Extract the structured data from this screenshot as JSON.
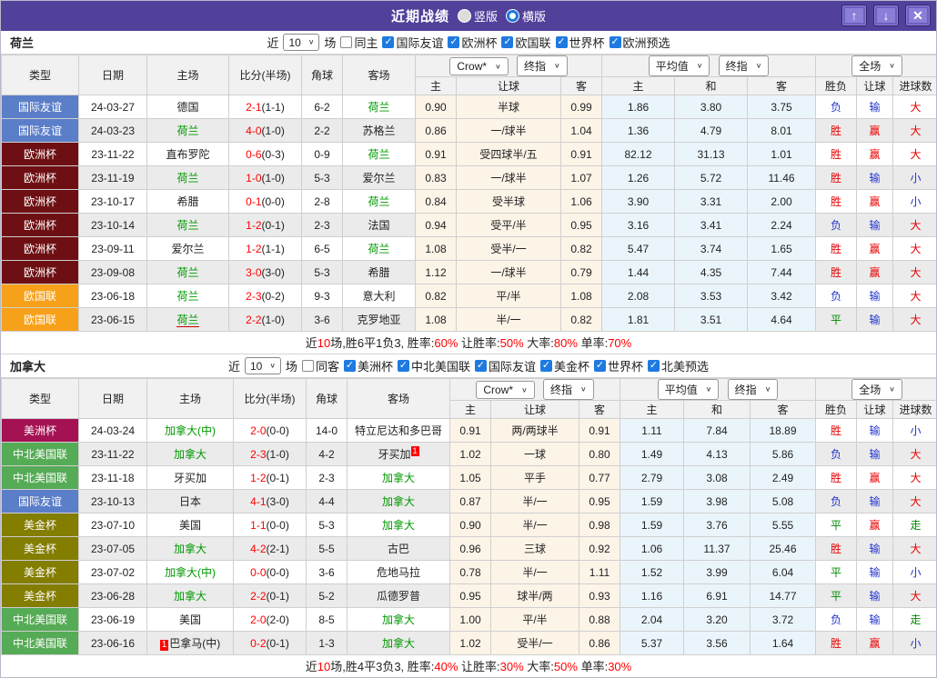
{
  "titlebar": {
    "title": "近期战绩",
    "radio_vertical": "竖版",
    "radio_horizontal": "横版",
    "up_icon": "↑",
    "down_icon": "↓",
    "close_icon": "✕"
  },
  "icons": {
    "caret": "∨",
    "check": "✓"
  },
  "table_header": {
    "type": "类型",
    "date": "日期",
    "home": "主场",
    "score": "比分(半场)",
    "corner": "角球",
    "away": "客场",
    "crow_select": "Crow*",
    "final_select": "终指",
    "avg_select": "平均值",
    "avg_final_select": "终指",
    "full_select": "全场",
    "sub_home": "主",
    "sub_handicap": "让球",
    "sub_away": "客",
    "sub_avg_home": "主",
    "sub_avg_draw": "和",
    "sub_avg_away": "客",
    "sub_wdl": "胜负",
    "sub_let": "让球",
    "sub_goals": "进球数"
  },
  "sections": [
    {
      "team": "荷兰",
      "filter": {
        "near": "近",
        "count": "10",
        "games": "场",
        "same": "同主",
        "leagues": [
          "国际友谊",
          "欧洲杯",
          "欧国联",
          "世界杯",
          "欧洲预选"
        ]
      },
      "rows": [
        {
          "type": "国际友谊",
          "type_bg": "#5b7ec8",
          "date": "24-03-27",
          "home": "德国",
          "score_full": "2-1",
          "score_half": "(1-1)",
          "corner": "6-2",
          "away": "荷兰",
          "away_green": true,
          "crow_home": "0.90",
          "crow_handicap": "半球",
          "crow_away": "0.99",
          "avg_home": "1.86",
          "avg_draw": "3.80",
          "avg_away": "3.75",
          "wdl": "负",
          "wdl_c": "b",
          "hres": "输",
          "hres_c": "b",
          "goals": "大",
          "goals_c": "r"
        },
        {
          "type": "国际友谊",
          "type_bg": "#5b7ec8",
          "date": "24-03-23",
          "home": "荷兰",
          "home_green": true,
          "score_full": "4-0",
          "score_half": "(1-0)",
          "corner": "2-2",
          "away": "苏格兰",
          "crow_home": "0.86",
          "crow_handicap": "一/球半",
          "crow_away": "1.04",
          "avg_home": "1.36",
          "avg_draw": "4.79",
          "avg_away": "8.01",
          "wdl": "胜",
          "wdl_c": "r",
          "hres": "赢",
          "hres_c": "r",
          "goals": "大",
          "goals_c": "r"
        },
        {
          "type": "欧洲杯",
          "type_bg": "#6e1013",
          "date": "23-11-22",
          "home": "直布罗陀",
          "score_full": "0-6",
          "score_half": "(0-3)",
          "corner": "0-9",
          "away": "荷兰",
          "away_green": true,
          "crow_home": "0.91",
          "crow_handicap": "受四球半/五",
          "crow_away": "0.91",
          "avg_home": "82.12",
          "avg_draw": "31.13",
          "avg_away": "1.01",
          "wdl": "胜",
          "wdl_c": "r",
          "hres": "赢",
          "hres_c": "r",
          "goals": "大",
          "goals_c": "r"
        },
        {
          "type": "欧洲杯",
          "type_bg": "#6e1013",
          "date": "23-11-19",
          "home": "荷兰",
          "home_green": true,
          "score_full": "1-0",
          "score_half": "(1-0)",
          "corner": "5-3",
          "away": "爱尔兰",
          "crow_home": "0.83",
          "crow_handicap": "一/球半",
          "crow_away": "1.07",
          "avg_home": "1.26",
          "avg_draw": "5.72",
          "avg_away": "11.46",
          "wdl": "胜",
          "wdl_c": "r",
          "hres": "输",
          "hres_c": "b",
          "goals": "小",
          "goals_c": "b"
        },
        {
          "type": "欧洲杯",
          "type_bg": "#6e1013",
          "date": "23-10-17",
          "home": "希腊",
          "score_full": "0-1",
          "score_half": "(0-0)",
          "corner": "2-8",
          "away": "荷兰",
          "away_green": true,
          "crow_home": "0.84",
          "crow_handicap": "受半球",
          "crow_away": "1.06",
          "avg_home": "3.90",
          "avg_draw": "3.31",
          "avg_away": "2.00",
          "wdl": "胜",
          "wdl_c": "r",
          "hres": "赢",
          "hres_c": "r",
          "goals": "小",
          "goals_c": "b"
        },
        {
          "type": "欧洲杯",
          "type_bg": "#6e1013",
          "date": "23-10-14",
          "home": "荷兰",
          "home_green": true,
          "score_full": "1-2",
          "score_half": "(0-1)",
          "corner": "2-3",
          "away": "法国",
          "crow_home": "0.94",
          "crow_handicap": "受平/半",
          "crow_away": "0.95",
          "avg_home": "3.16",
          "avg_draw": "3.41",
          "avg_away": "2.24",
          "wdl": "负",
          "wdl_c": "b",
          "hres": "输",
          "hres_c": "b",
          "goals": "大",
          "goals_c": "r"
        },
        {
          "type": "欧洲杯",
          "type_bg": "#6e1013",
          "date": "23-09-11",
          "home": "爱尔兰",
          "score_full": "1-2",
          "score_half": "(1-1)",
          "corner": "6-5",
          "away": "荷兰",
          "away_green": true,
          "crow_home": "1.08",
          "crow_handicap": "受半/一",
          "crow_away": "0.82",
          "avg_home": "5.47",
          "avg_draw": "3.74",
          "avg_away": "1.65",
          "wdl": "胜",
          "wdl_c": "r",
          "hres": "赢",
          "hres_c": "r",
          "goals": "大",
          "goals_c": "r"
        },
        {
          "type": "欧洲杯",
          "type_bg": "#6e1013",
          "date": "23-09-08",
          "home": "荷兰",
          "home_green": true,
          "score_full": "3-0",
          "score_half": "(3-0)",
          "corner": "5-3",
          "away": "希腊",
          "crow_home": "1.12",
          "crow_handicap": "一/球半",
          "crow_away": "0.79",
          "avg_home": "1.44",
          "avg_draw": "4.35",
          "avg_away": "7.44",
          "wdl": "胜",
          "wdl_c": "r",
          "hres": "赢",
          "hres_c": "r",
          "goals": "大",
          "goals_c": "r"
        },
        {
          "type": "欧国联",
          "type_bg": "#f7a11a",
          "date": "23-06-18",
          "home": "荷兰",
          "home_green": true,
          "score_full": "2-3",
          "score_half": "(0-2)",
          "corner": "9-3",
          "away": "意大利",
          "crow_home": "0.82",
          "crow_handicap": "平/半",
          "crow_away": "1.08",
          "avg_home": "2.08",
          "avg_draw": "3.53",
          "avg_away": "3.42",
          "wdl": "负",
          "wdl_c": "b",
          "hres": "输",
          "hres_c": "b",
          "goals": "大",
          "goals_c": "r"
        },
        {
          "type": "欧国联",
          "type_bg": "#f7a11a",
          "date": "23-06-15",
          "home": "荷兰",
          "home_green": true,
          "home_underline": true,
          "score_full": "2-2",
          "score_half": "(1-0)",
          "corner": "3-6",
          "away": "克罗地亚",
          "crow_home": "1.08",
          "crow_handicap": "半/一",
          "crow_away": "0.82",
          "avg_home": "1.81",
          "avg_draw": "3.51",
          "avg_away": "4.64",
          "wdl": "平",
          "wdl_c": "g",
          "hres": "输",
          "hres_c": "b",
          "goals": "大",
          "goals_c": "r"
        }
      ],
      "summary": {
        "t1": "近",
        "n1": "10",
        "t2": "场,胜6平1负3, 胜率:",
        "n2": "60%",
        "t3": " 让胜率:",
        "n3": "50%",
        "t4": " 大率:",
        "n4": "80%",
        "t5": " 单率:",
        "n5": "70%"
      }
    },
    {
      "team": "加拿大",
      "filter": {
        "near": "近",
        "count": "10",
        "games": "场",
        "same": "同客",
        "leagues": [
          "美洲杯",
          "中北美国联",
          "国际友谊",
          "美金杯",
          "世界杯",
          "北美预选"
        ]
      },
      "rows": [
        {
          "type": "美洲杯",
          "type_bg": "#a51253",
          "date": "24-03-24",
          "home": "加拿大(中)",
          "home_green": true,
          "score_full": "2-0",
          "score_half": "(0-0)",
          "corner": "14-0",
          "away": "特立尼达和多巴哥",
          "crow_home": "0.91",
          "crow_handicap": "两/两球半",
          "crow_away": "0.91",
          "avg_home": "1.11",
          "avg_draw": "7.84",
          "avg_away": "18.89",
          "wdl": "胜",
          "wdl_c": "r",
          "hres": "输",
          "hres_c": "b",
          "goals": "小",
          "goals_c": "b"
        },
        {
          "type": "中北美国联",
          "type_bg": "#56ab56",
          "date": "23-11-22",
          "home": "加拿大",
          "home_green": true,
          "score_full": "2-3",
          "score_half": "(1-0)",
          "corner": "4-2",
          "away": "牙买加",
          "away_card": "1",
          "crow_home": "1.02",
          "crow_handicap": "一球",
          "crow_away": "0.80",
          "avg_home": "1.49",
          "avg_draw": "4.13",
          "avg_away": "5.86",
          "wdl": "负",
          "wdl_c": "b",
          "hres": "输",
          "hres_c": "b",
          "goals": "大",
          "goals_c": "r"
        },
        {
          "type": "中北美国联",
          "type_bg": "#56ab56",
          "date": "23-11-18",
          "home": "牙买加",
          "score_full": "1-2",
          "score_half": "(0-1)",
          "corner": "2-3",
          "away": "加拿大",
          "away_green": true,
          "crow_home": "1.05",
          "crow_handicap": "平手",
          "crow_away": "0.77",
          "avg_home": "2.79",
          "avg_draw": "3.08",
          "avg_away": "2.49",
          "wdl": "胜",
          "wdl_c": "r",
          "hres": "赢",
          "hres_c": "r",
          "goals": "大",
          "goals_c": "r"
        },
        {
          "type": "国际友谊",
          "type_bg": "#5b7ec8",
          "date": "23-10-13",
          "home": "日本",
          "score_full": "4-1",
          "score_half": "(3-0)",
          "corner": "4-4",
          "away": "加拿大",
          "away_green": true,
          "crow_home": "0.87",
          "crow_handicap": "半/一",
          "crow_away": "0.95",
          "avg_home": "1.59",
          "avg_draw": "3.98",
          "avg_away": "5.08",
          "wdl": "负",
          "wdl_c": "b",
          "hres": "输",
          "hres_c": "b",
          "goals": "大",
          "goals_c": "r"
        },
        {
          "type": "美金杯",
          "type_bg": "#837d00",
          "date": "23-07-10",
          "home": "美国",
          "score_full": "1-1",
          "score_half": "(0-0)",
          "corner": "5-3",
          "away": "加拿大",
          "away_green": true,
          "crow_home": "0.90",
          "crow_handicap": "半/一",
          "crow_away": "0.98",
          "avg_home": "1.59",
          "avg_draw": "3.76",
          "avg_away": "5.55",
          "wdl": "平",
          "wdl_c": "g",
          "hres": "赢",
          "hres_c": "r",
          "goals": "走",
          "goals_c": "g"
        },
        {
          "type": "美金杯",
          "type_bg": "#837d00",
          "date": "23-07-05",
          "home": "加拿大",
          "home_green": true,
          "score_full": "4-2",
          "score_half": "(2-1)",
          "corner": "5-5",
          "away": "古巴",
          "crow_home": "0.96",
          "crow_handicap": "三球",
          "crow_away": "0.92",
          "avg_home": "1.06",
          "avg_draw": "11.37",
          "avg_away": "25.46",
          "wdl": "胜",
          "wdl_c": "r",
          "hres": "输",
          "hres_c": "b",
          "goals": "大",
          "goals_c": "r"
        },
        {
          "type": "美金杯",
          "type_bg": "#837d00",
          "date": "23-07-02",
          "home": "加拿大(中)",
          "home_green": true,
          "score_full": "0-0",
          "score_half": "(0-0)",
          "corner": "3-6",
          "away": "危地马拉",
          "crow_home": "0.78",
          "crow_handicap": "半/一",
          "crow_away": "1.11",
          "avg_home": "1.52",
          "avg_draw": "3.99",
          "avg_away": "6.04",
          "wdl": "平",
          "wdl_c": "g",
          "hres": "输",
          "hres_c": "b",
          "goals": "小",
          "goals_c": "b"
        },
        {
          "type": "美金杯",
          "type_bg": "#837d00",
          "date": "23-06-28",
          "home": "加拿大",
          "home_green": true,
          "score_full": "2-2",
          "score_half": "(0-1)",
          "corner": "5-2",
          "away": "瓜德罗普",
          "crow_home": "0.95",
          "crow_handicap": "球半/两",
          "crow_away": "0.93",
          "avg_home": "1.16",
          "avg_draw": "6.91",
          "avg_away": "14.77",
          "wdl": "平",
          "wdl_c": "g",
          "hres": "输",
          "hres_c": "b",
          "goals": "大",
          "goals_c": "r"
        },
        {
          "type": "中北美国联",
          "type_bg": "#56ab56",
          "date": "23-06-19",
          "home": "美国",
          "score_full": "2-0",
          "score_half": "(2-0)",
          "corner": "8-5",
          "away": "加拿大",
          "away_green": true,
          "crow_home": "1.00",
          "crow_handicap": "平/半",
          "crow_away": "0.88",
          "avg_home": "2.04",
          "avg_draw": "3.20",
          "avg_away": "3.72",
          "wdl": "负",
          "wdl_c": "b",
          "hres": "输",
          "hres_c": "b",
          "goals": "走",
          "goals_c": "g"
        },
        {
          "type": "中北美国联",
          "type_bg": "#56ab56",
          "date": "23-06-16",
          "home": "巴拿马(中)",
          "home_card": "1",
          "score_full": "0-2",
          "score_half": "(0-1)",
          "corner": "1-3",
          "away": "加拿大",
          "away_green": true,
          "crow_home": "1.02",
          "crow_handicap": "受半/一",
          "crow_away": "0.86",
          "avg_home": "5.37",
          "avg_draw": "3.56",
          "avg_away": "1.64",
          "wdl": "胜",
          "wdl_c": "r",
          "hres": "赢",
          "hres_c": "r",
          "goals": "小",
          "goals_c": "b"
        }
      ],
      "summary": {
        "t1": "近",
        "n1": "10",
        "t2": "场,胜4平3负3, 胜率:",
        "n2": "40%",
        "t3": " 让胜率:",
        "n3": "30%",
        "t4": " 大率:",
        "n4": "50%",
        "t5": " 单率:",
        "n5": "30%"
      }
    }
  ]
}
